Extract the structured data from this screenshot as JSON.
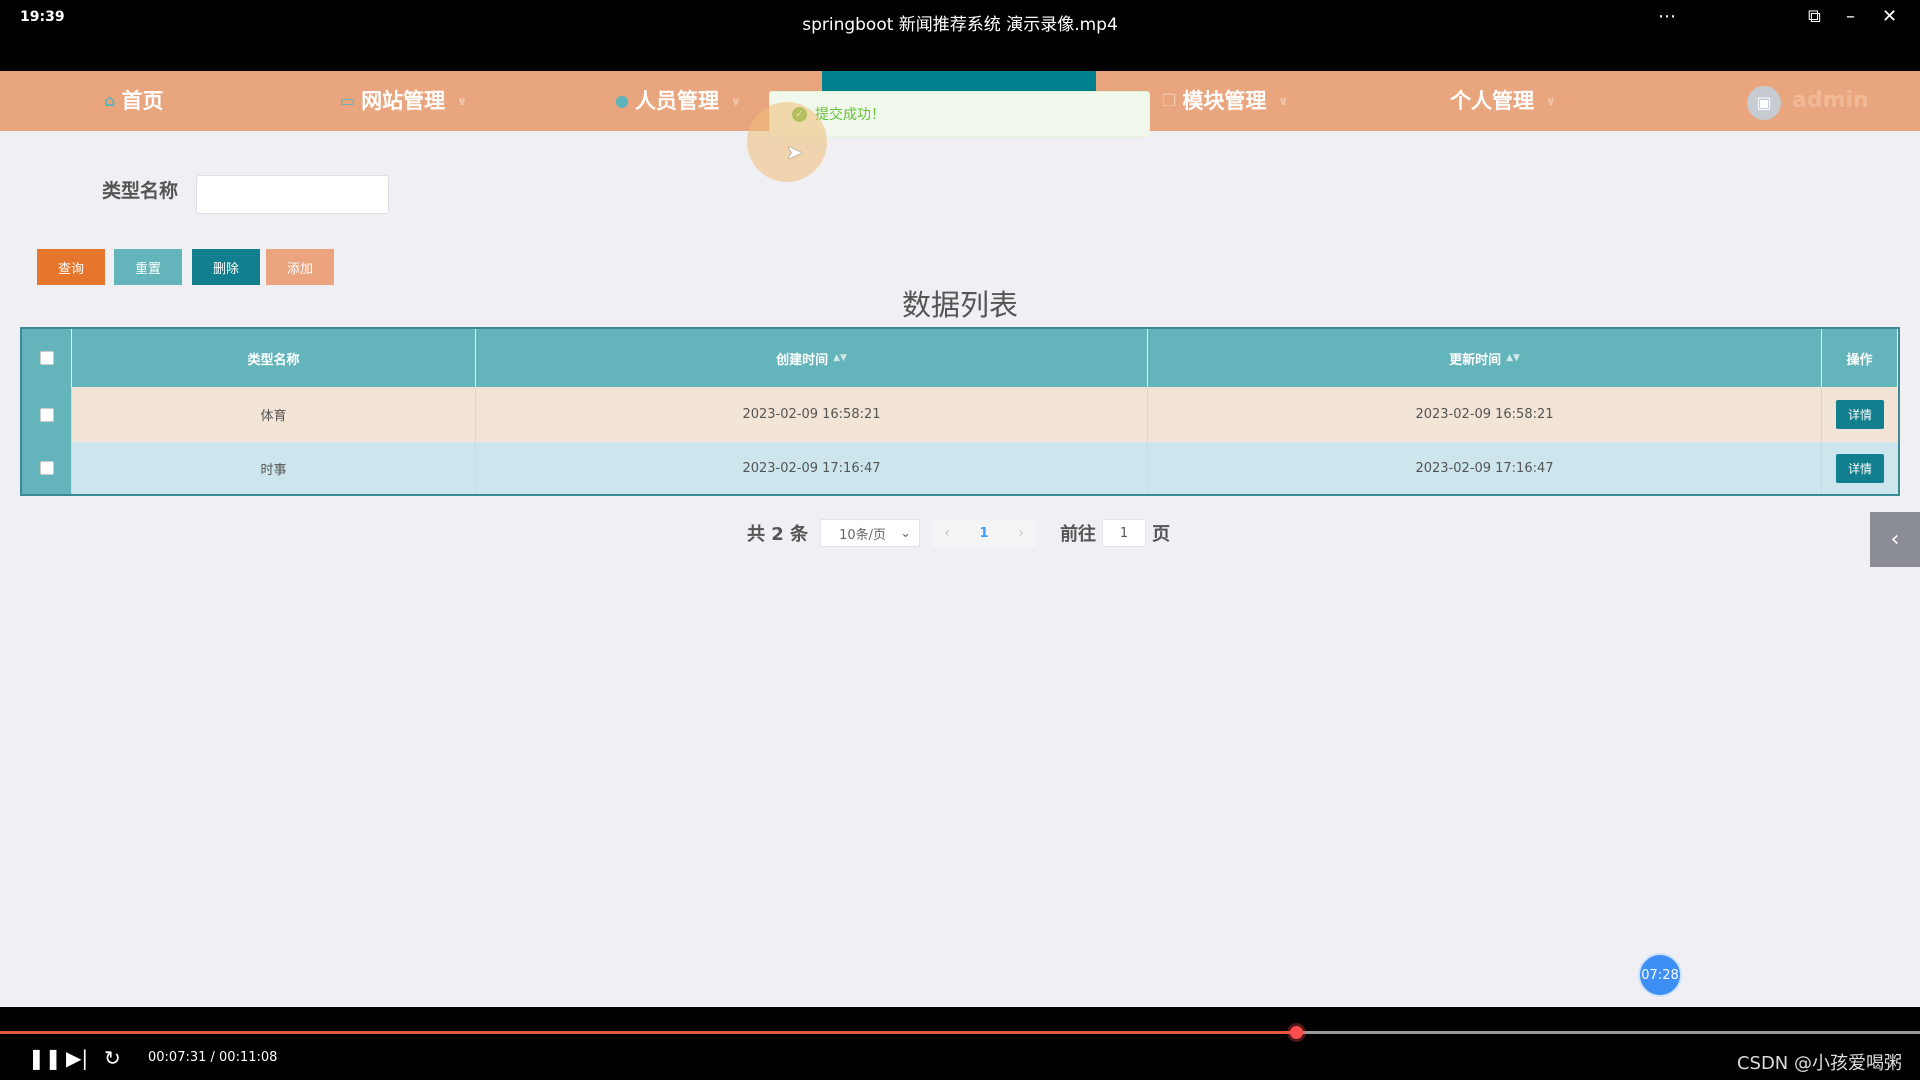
{
  "player": {
    "clock": "19:39",
    "title": "springboot 新闻推荐系统 演示录像.mp4",
    "time": "00:07:31 / 00:11:08",
    "progress": 0.675,
    "bubble_time": "07:28",
    "watermark": "CSDN @小孩爱喝粥"
  },
  "nav": {
    "items": [
      {
        "label": "首页",
        "icon": "home-icon"
      },
      {
        "label": "网站管理",
        "icon": "monitor-icon"
      },
      {
        "label": "人员管理",
        "icon": "user-icon"
      },
      {
        "label": "模块管理",
        "icon": "copy-icon"
      },
      {
        "label": "个人管理"
      }
    ],
    "user": "admin"
  },
  "toast": {
    "message": "提交成功！"
  },
  "search": {
    "label": "类型名称",
    "value": "",
    "placeholder": ""
  },
  "buttons": {
    "query": "查询",
    "reset": "重置",
    "delete": "删除",
    "add": "添加"
  },
  "list_title": "数据列表",
  "table": {
    "headers": [
      "类型名称",
      "创建时间",
      "更新时间",
      "操作"
    ],
    "rows": [
      {
        "name": "体育",
        "created": "2023-02-09 16:58:21",
        "updated": "2023-02-09 16:58:21",
        "action": "详情"
      },
      {
        "name": "时事",
        "created": "2023-02-09 17:16:47",
        "updated": "2023-02-09 17:16:47",
        "action": "详情"
      }
    ]
  },
  "pagination": {
    "total": "共 2 条",
    "page_size": "10条/页",
    "current": "1",
    "goto_label": "前往",
    "goto_value": "1",
    "page_suffix": "页"
  },
  "colors": {
    "nav": "#e9a57e",
    "header": "#64b4bb",
    "row1": "#f2e4d6",
    "row2": "#cde6ee",
    "query": "#e6762c",
    "reset": "#64b4bb",
    "delete": "#117f8d",
    "add": "#eba47e"
  }
}
